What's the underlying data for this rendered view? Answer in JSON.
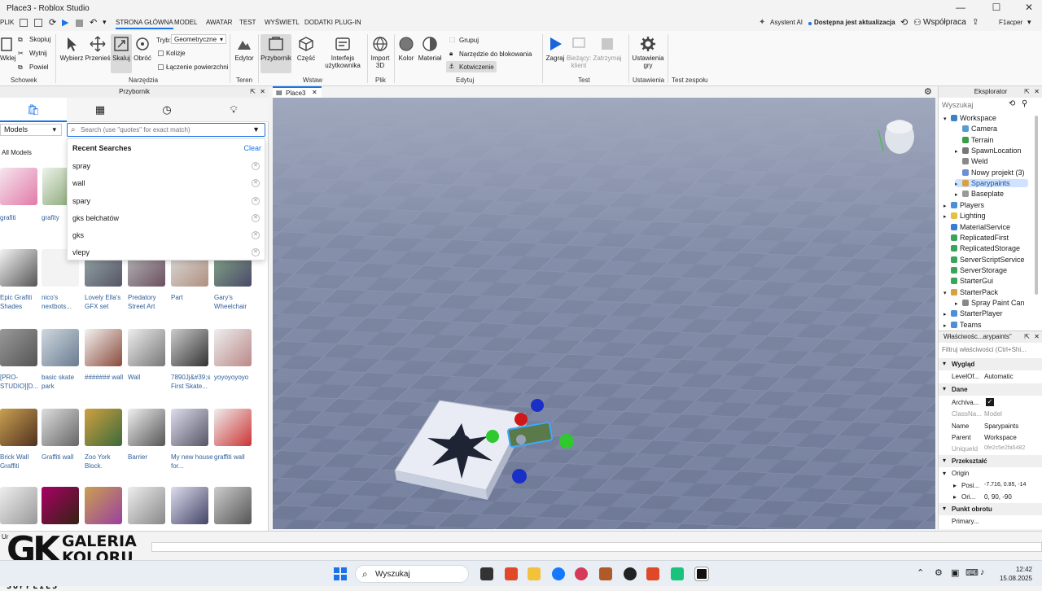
{
  "window": {
    "title": "Place3 - Roblox Studio"
  },
  "menu": {
    "items": [
      "PLIK",
      "STRONA GŁÓWNA",
      "MODEL",
      "AWATAR",
      "TEST",
      "WYŚWIETL",
      "DODATKI PLUG-IN"
    ],
    "active": "STRONA GŁÓWNA",
    "right": {
      "assistant": "Asystent AI",
      "update": "Dostępna jest aktualizacja",
      "collab": "Współpraca",
      "user": "F1acper"
    }
  },
  "ribbon": {
    "clipboard": {
      "paste": "Wklej",
      "copy": "Skopiuj",
      "cut": "Wytnij",
      "duplicate": "Powiel",
      "group": "Schowek"
    },
    "tools": {
      "select": "Wybierz",
      "move": "Przenieś",
      "scale": "Skaluj",
      "rotate": "Obróć",
      "mode_label": "Tryb:",
      "mode_value": "Geometryczne",
      "collisions": "Kolizje",
      "joins": "Łączenie powierzchni",
      "group": "Narzędzia"
    },
    "terrain": {
      "editor": "Edytor",
      "group": "Teren"
    },
    "insert": {
      "toolbox": "Przybornik",
      "part": "Część",
      "ui": "Interfejs użytkownika",
      "group": "Wstaw"
    },
    "file": {
      "import": "Import 3D",
      "group": "Plik"
    },
    "edit": {
      "color": "Kolor",
      "material": "Materiał",
      "group_btn": "Grupuj",
      "lock": "Narzędzie do blokowania",
      "anchor": "Kotwiczenie",
      "group": "Edytuj"
    },
    "test": {
      "play": "Zagraj",
      "client": "Bieżący: klient",
      "stop": "Zatrzymaj",
      "group": "Test"
    },
    "settings": {
      "game_settings": "Ustawienia gry",
      "group": "Ustawienia"
    },
    "team": {
      "group": "Test zespołu"
    }
  },
  "toolbox": {
    "title": "Przybornik",
    "category": "Models",
    "search_placeholder": "Search (use \"quotes\" for exact match)",
    "all_models": "All Models",
    "recent_title": "Recent Searches",
    "clear": "Clear",
    "recent": [
      "spray",
      "wall",
      "spary",
      "gks bełchatów",
      "gks",
      "vlepy"
    ],
    "items": [
      "grafiti",
      "grafity",
      "Epic Grafiti Shades",
      "nico's nextbots...",
      "Lovely Ella's GFX set",
      "Predatory Street Art",
      "Part",
      "Gary's Wheelchair",
      "[PRO-STUDIO][D...",
      "basic skate park",
      "####### wall",
      "Wall",
      "7890Jj&#39;s First Skate...",
      "yoyoyoyoyo",
      "Brick Wall Graffiti",
      "Graffiti wall",
      "Zoo York Block.",
      "Barrier",
      "My new house for...",
      "graffiti wall"
    ]
  },
  "viewport": {
    "tab": "Place3"
  },
  "explorer": {
    "title": "Eksplorator",
    "search_placeholder": "Wyszukaj",
    "tree": [
      {
        "label": "Workspace",
        "depth": 0,
        "color": "#3b82c4"
      },
      {
        "label": "Camera",
        "depth": 1,
        "color": "#5a9bd4"
      },
      {
        "label": "Terrain",
        "depth": 1,
        "color": "#3c9c4a"
      },
      {
        "label": "SpawnLocation",
        "depth": 1,
        "color": "#777777"
      },
      {
        "label": "Weld",
        "depth": 1,
        "color": "#888888"
      },
      {
        "label": "Nowy projekt (3)",
        "depth": 1,
        "color": "#6c8fd6"
      },
      {
        "label": "Sparypaints",
        "depth": 1,
        "color": "#d8a040",
        "selected": true
      },
      {
        "label": "Baseplate",
        "depth": 1,
        "color": "#999999"
      },
      {
        "label": "Players",
        "depth": 0,
        "color": "#4a8fd8"
      },
      {
        "label": "Lighting",
        "depth": 0,
        "color": "#e6c040"
      },
      {
        "label": "MaterialService",
        "depth": 0,
        "color": "#3a7bd5"
      },
      {
        "label": "ReplicatedFirst",
        "depth": 0,
        "color": "#3aa55a"
      },
      {
        "label": "ReplicatedStorage",
        "depth": 0,
        "color": "#3aa55a"
      },
      {
        "label": "ServerScriptService",
        "depth": 0,
        "color": "#3aa55a"
      },
      {
        "label": "ServerStorage",
        "depth": 0,
        "color": "#3aa55a"
      },
      {
        "label": "StarterGui",
        "depth": 0,
        "color": "#3aa55a"
      },
      {
        "label": "StarterPack",
        "depth": 0,
        "color": "#d8a040"
      },
      {
        "label": "Spray Paint Can",
        "depth": 1,
        "color": "#888888"
      },
      {
        "label": "StarterPlayer",
        "depth": 0,
        "color": "#4a8fd8"
      },
      {
        "label": "Teams",
        "depth": 0,
        "color": "#4a8fd8"
      }
    ]
  },
  "properties": {
    "title": "Właściwośc...arypaints\"",
    "filter_placeholder": "Filtruj właściwości (Ctrl+Shi...",
    "sections": {
      "appearance": "Wygląd",
      "data": "Dane",
      "transform": "Przekształć",
      "pivot": "Punkt obrotu"
    },
    "rows": {
      "level": [
        "LevelOf...",
        "Automatic"
      ],
      "archivable": "Archiva...",
      "classname": [
        "ClassNa...",
        "Model"
      ],
      "name": [
        "Name",
        "Sparypaints"
      ],
      "parent": [
        "Parent",
        "Workspace"
      ],
      "uniqueid": [
        "UniqueId",
        "0fe2c5e2fa5482"
      ],
      "origin": "Origin",
      "position": [
        "Posi...",
        "-7.716, 0.85, -14"
      ],
      "orientation": [
        "Ori...",
        "0, 90, -90"
      ],
      "primary": "Primary..."
    }
  },
  "cmdbar": {
    "prefix": "Ur"
  },
  "watermark": {
    "line1": "GALERIA",
    "line2": "KOLORU",
    "line3": "GRAFFITI & ART SUPPLIES",
    "mark": "GK"
  },
  "taskbar": {
    "search": "Wyszukaj",
    "time": "12:42",
    "date": "15.08.2025"
  }
}
